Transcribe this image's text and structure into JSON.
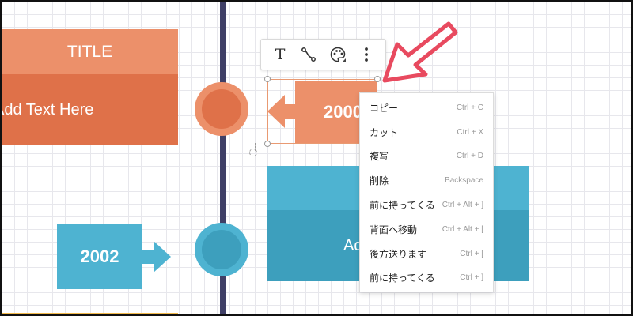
{
  "canvas": {
    "title_card": {
      "title": "TITLE",
      "body": "Add Text Here"
    },
    "date_selected": "2000",
    "date_second": "2002",
    "blue_card": {
      "body": "Add Text Here"
    }
  },
  "toolbar": {
    "buttons": [
      {
        "icon": "text-icon",
        "glyph": "T"
      },
      {
        "icon": "connector-icon"
      },
      {
        "icon": "palette-icon"
      },
      {
        "icon": "more-vertical-icon"
      }
    ]
  },
  "context_menu": {
    "items": [
      {
        "label": "コピー",
        "shortcut": "Ctrl + C"
      },
      {
        "label": "カット",
        "shortcut": "Ctrl + X"
      },
      {
        "label": "複写",
        "shortcut": "Ctrl + D"
      },
      {
        "label": "削除",
        "shortcut": "Backspace"
      },
      {
        "label": "前に持ってくる",
        "shortcut": "Ctrl + Alt + ]"
      },
      {
        "label": "背面へ移動",
        "shortcut": "Ctrl + Alt + ["
      },
      {
        "label": "後方送ります",
        "shortcut": "Ctrl + ["
      },
      {
        "label": "前に持ってくる",
        "shortcut": "Ctrl + ]"
      }
    ]
  },
  "colors": {
    "orange_light": "#ec906a",
    "orange_dark": "#df7149",
    "blue_light": "#4eb3d1",
    "blue_dark": "#3d9fbd",
    "timeline": "#3f3f66",
    "pointer_arrow": "#e84a5f"
  }
}
